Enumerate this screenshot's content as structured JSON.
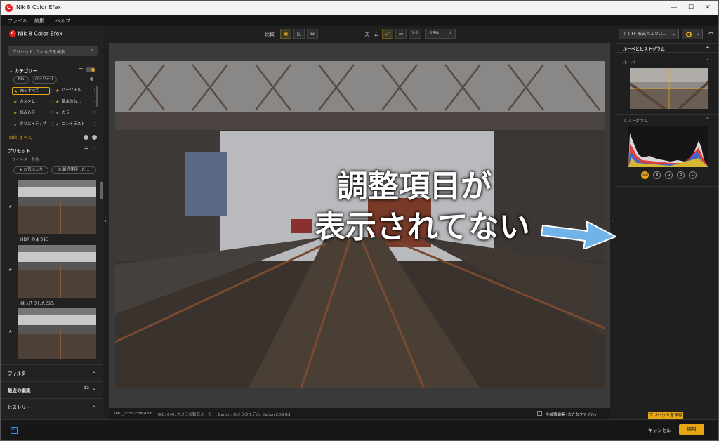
{
  "window": {
    "title": "Nik 8 Color Efex"
  },
  "menu": [
    "ファイル",
    "編集",
    "ヘルプ"
  ],
  "sidebar": {
    "app_name": "Nik 8 Color Efex",
    "search_placeholder": "プリセット, フィルタを検索...",
    "category_header": "カテゴリー",
    "tags": [
      "Nik",
      "パーソナル"
    ],
    "categories": [
      "Nik すべて",
      "パーソナル...",
      "カスタム",
      "基本的な...",
      "読み込み",
      "カラー",
      "クリエイティブ",
      "コントラスト"
    ],
    "current_category": "Nik すべて",
    "presets_header": "プリセット",
    "filter_conditions": "フィルター条件:",
    "filter_chips": [
      "お気に入り",
      "最近使用した..."
    ],
    "presets": [
      "HDR のように",
      "はっきりした凹凸"
    ],
    "sections": [
      "フィルタ",
      "最近の編集",
      "ヒストリー"
    ],
    "recent_count": "12"
  },
  "toolbar": {
    "compare_label": "比較",
    "zoom_label": "ズーム",
    "zoom_1to1": "1:1",
    "zoom_value": "15%"
  },
  "overlay": {
    "line1": "調整項目が",
    "line2": "表示されてない"
  },
  "status": {
    "filename": "IMG_1355-Edit-4.tif",
    "meta": "ISO: 640, カメラの製造メーカー: Canon, カメラのモデル: Canon EOS RS",
    "nondestructive": "非破壊編集 (大きなファイル)"
  },
  "right": {
    "export_label": "TIFF 形式でエクス...",
    "panel_title": "ルーペとヒストグラム",
    "loupe_label": "ルーペ",
    "histogram_label": "ヒストグラム",
    "channels": [
      "RGB",
      "R",
      "G",
      "B",
      "L"
    ],
    "save_preset": "プリセットを保存"
  },
  "footer": {
    "cancel": "キャンセル",
    "apply": "適用",
    "lrc": "LrC"
  },
  "colors": {
    "accent": "#e6a514",
    "arrow": "#6fb3e8"
  }
}
